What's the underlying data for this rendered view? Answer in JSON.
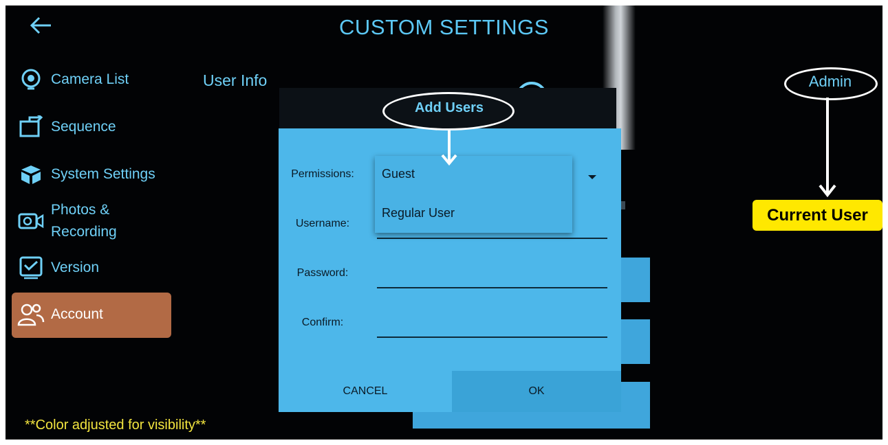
{
  "header": {
    "title": "CUSTOM SETTINGS",
    "back_icon": "back-arrow-icon"
  },
  "sidebar": {
    "items": [
      {
        "label": "Camera List",
        "icon": "camera-icon"
      },
      {
        "label": "Sequence",
        "icon": "sequence-icon"
      },
      {
        "label": "System Settings",
        "icon": "cube-icon"
      },
      {
        "label_line1": "Photos &",
        "label_line2": "Recording",
        "icon": "video-camera-icon"
      },
      {
        "label": "Version",
        "icon": "version-icon"
      },
      {
        "label": "Account",
        "icon": "users-icon",
        "selected": true
      }
    ]
  },
  "main": {
    "section_title": "User Info"
  },
  "dialog": {
    "title": "Add Users",
    "permissions_label": "Permissions:",
    "username_label": "Username:",
    "password_label": "Password:",
    "confirm_label": "Confirm:",
    "permissions_options": [
      "Guest",
      "Regular User"
    ],
    "cancel_label": "CANCEL",
    "ok_label": "OK"
  },
  "annotations": {
    "admin_label": "Admin",
    "current_user_label": "Current User",
    "note": "**Color adjusted for visibility**"
  },
  "colors": {
    "background": "#020305",
    "accent_text": "#6fd0f7",
    "dialog_bg": "#4db7ea",
    "account_selected": "#b26a45",
    "current_user_badge": "#ffe800",
    "note_text": "#f3e53f"
  }
}
